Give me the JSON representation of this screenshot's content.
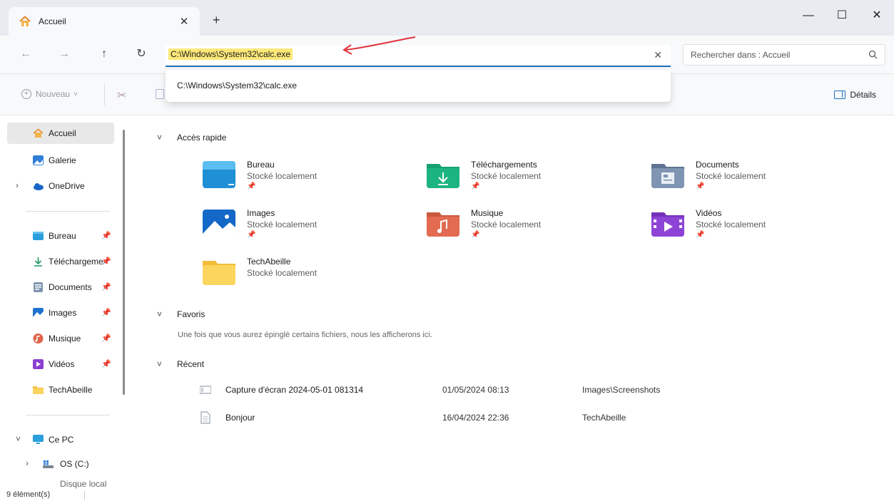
{
  "tab": {
    "title": "Accueil",
    "close_glyph": "✕",
    "new_glyph": "+"
  },
  "window": {
    "minimize": "—",
    "maximize": "☐",
    "close": "✕"
  },
  "nav": {
    "back": "←",
    "forward": "→",
    "up": "↑",
    "refresh": "↻"
  },
  "address": {
    "value": "C:\\Windows\\System32\\calc.exe",
    "clear_glyph": "✕",
    "suggestion": "C:\\Windows\\System32\\calc.exe"
  },
  "search": {
    "placeholder": "Rechercher dans : Accueil"
  },
  "toolbar": {
    "new_label": "Nouveau",
    "new_chevron": "˅",
    "details_label": "Détails"
  },
  "sidebar": {
    "top": [
      {
        "label": "Accueil",
        "icon": "home-icon"
      },
      {
        "label": "Galerie",
        "icon": "gallery-icon"
      },
      {
        "label": "OneDrive",
        "icon": "cloud-icon"
      }
    ],
    "pinned": [
      {
        "label": "Bureau",
        "icon": "desktop-folder-icon"
      },
      {
        "label": "Téléchargements",
        "icon": "download-icon"
      },
      {
        "label": "Documents",
        "icon": "documents-icon"
      },
      {
        "label": "Images",
        "icon": "images-icon"
      },
      {
        "label": "Musique",
        "icon": "music-icon"
      },
      {
        "label": "Vidéos",
        "icon": "video-icon"
      },
      {
        "label": "TechAbeille",
        "icon": "folder-icon"
      }
    ],
    "pc": {
      "label": "Ce PC",
      "drive": "OS (C:)",
      "partial": "Disque local"
    }
  },
  "quick_access": {
    "title": "Accès rapide",
    "items": [
      {
        "name": "Bureau",
        "sub": "Stocké localement"
      },
      {
        "name": "Téléchargements",
        "sub": "Stocké localement"
      },
      {
        "name": "Documents",
        "sub": "Stocké localement"
      },
      {
        "name": "Images",
        "sub": "Stocké localement"
      },
      {
        "name": "Musique",
        "sub": "Stocké localement"
      },
      {
        "name": "Vidéos",
        "sub": "Stocké localement"
      },
      {
        "name": "TechAbeille",
        "sub": "Stocké localement"
      }
    ]
  },
  "favorites": {
    "title": "Favoris",
    "empty": "Une fois que vous aurez épinglé certains fichiers, nous les afficherons ici."
  },
  "recent": {
    "title": "Récent",
    "rows": [
      {
        "name": "Capture d'écran 2024-05-01 081314",
        "date": "01/05/2024 08:13",
        "location": "Images\\Screenshots"
      },
      {
        "name": "Bonjour",
        "date": "16/04/2024 22:36",
        "location": "TechAbeille"
      }
    ]
  },
  "status": {
    "count": "9 élément(s)"
  },
  "colors": {
    "accent": "#1a6fbf",
    "highlight": "#fce879",
    "annotation_arrow": "#e2323c"
  }
}
